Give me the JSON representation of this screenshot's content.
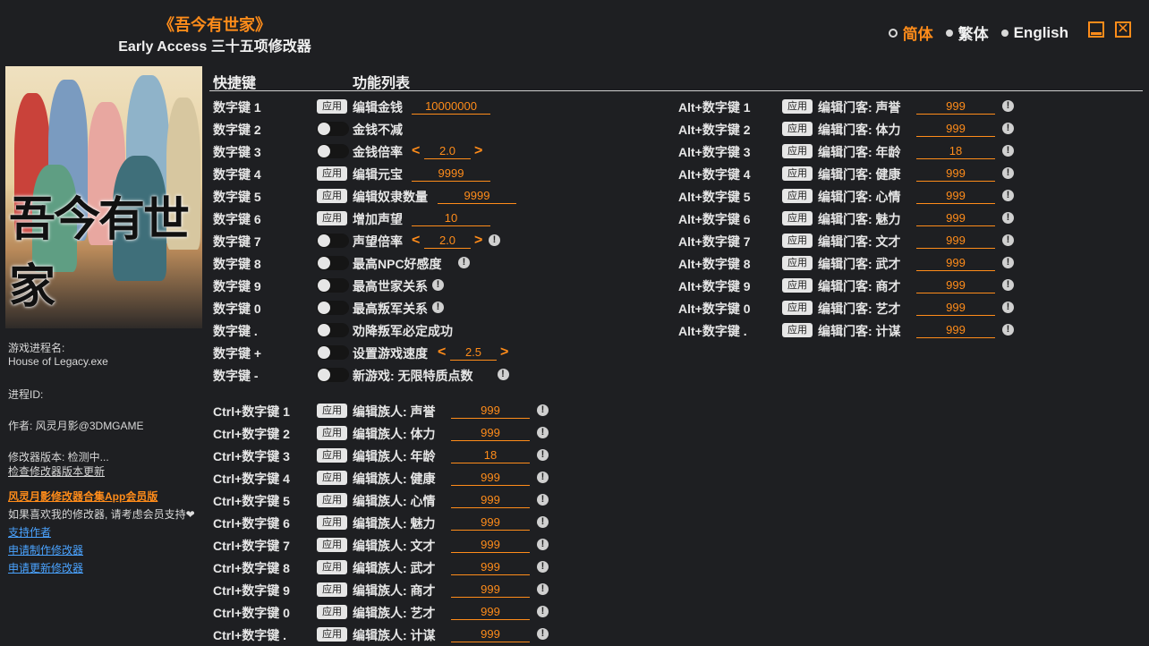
{
  "title": {
    "main": "《吾今有世家》",
    "sub": "Early Access 三十五项修改器"
  },
  "languages": [
    {
      "label": "简体",
      "selected": true
    },
    {
      "label": "繁体",
      "selected": false
    },
    {
      "label": "English",
      "selected": false
    }
  ],
  "window_controls": {
    "minimize_icon": "minimize-icon",
    "close_icon": "close-icon",
    "close_glyph": "✕"
  },
  "cover": {
    "logo_text": "吾今有世家"
  },
  "sidebar": {
    "process_name_label": "游戏进程名:",
    "process_name": "House of Legacy.exe",
    "process_id_label": "进程ID:",
    "author": "作者: 风灵月影@3DMGAME",
    "version": "修改器版本: 检测中...",
    "check_update": "检查修改器版本更新",
    "app_link": "风灵月影修改器合集App会员版",
    "support_text": "如果喜欢我的修改器, 请考虑会员支持",
    "heart": "❤",
    "links": [
      "支持作者",
      "申请制作修改器",
      "申请更新修改器"
    ]
  },
  "headers": {
    "hotkey": "快捷键",
    "function_list": "功能列表"
  },
  "controls": {
    "apply_label": "应用",
    "info_glyph": "!",
    "left_arrow": "<",
    "right_arrow": ">"
  },
  "left_rows": [
    {
      "key": "数字键 1",
      "type": "apply",
      "label": "编辑金钱",
      "value": "10000000",
      "info": false
    },
    {
      "key": "数字键 2",
      "type": "toggle",
      "label": "金钱不减",
      "info": false
    },
    {
      "key": "数字键 3",
      "type": "slider",
      "label": "金钱倍率",
      "value": "2.0",
      "info": false
    },
    {
      "key": "数字键 4",
      "type": "apply",
      "label": "编辑元宝",
      "value": "9999",
      "info": false
    },
    {
      "key": "数字键 5",
      "type": "apply",
      "label": "编辑奴隶数量",
      "value": "9999",
      "info": false
    },
    {
      "key": "数字键 6",
      "type": "apply",
      "label": "增加声望",
      "value": "10",
      "info": false
    },
    {
      "key": "数字键 7",
      "type": "slider",
      "label": "声望倍率",
      "value": "2.0",
      "info": true
    },
    {
      "key": "数字键 8",
      "type": "toggle",
      "label": "最高NPC好感度",
      "info": true
    },
    {
      "key": "数字键 9",
      "type": "toggle",
      "label": "最高世家关系",
      "info": true
    },
    {
      "key": "数字键 0",
      "type": "toggle",
      "label": "最高叛军关系",
      "info": true
    },
    {
      "key": "数字键 .",
      "type": "toggle",
      "label": "劝降叛军必定成功",
      "info": false
    },
    {
      "key": "数字键 +",
      "type": "slider",
      "label": "设置游戏速度",
      "value": "2.5",
      "info": false
    },
    {
      "key": "数字键 -",
      "type": "toggle",
      "label": "新游戏: 无限特质点数",
      "info": true
    }
  ],
  "ctrl_rows": [
    {
      "key": "Ctrl+数字键 1",
      "label": "编辑族人: 声誉",
      "value": "999"
    },
    {
      "key": "Ctrl+数字键 2",
      "label": "编辑族人: 体力",
      "value": "999"
    },
    {
      "key": "Ctrl+数字键 3",
      "label": "编辑族人: 年龄",
      "value": "18"
    },
    {
      "key": "Ctrl+数字键 4",
      "label": "编辑族人: 健康",
      "value": "999"
    },
    {
      "key": "Ctrl+数字键 5",
      "label": "编辑族人: 心情",
      "value": "999"
    },
    {
      "key": "Ctrl+数字键 6",
      "label": "编辑族人: 魅力",
      "value": "999"
    },
    {
      "key": "Ctrl+数字键 7",
      "label": "编辑族人: 文才",
      "value": "999"
    },
    {
      "key": "Ctrl+数字键 8",
      "label": "编辑族人: 武才",
      "value": "999"
    },
    {
      "key": "Ctrl+数字键 9",
      "label": "编辑族人: 商才",
      "value": "999"
    },
    {
      "key": "Ctrl+数字键 0",
      "label": "编辑族人: 艺才",
      "value": "999"
    },
    {
      "key": "Ctrl+数字键 .",
      "label": "编辑族人: 计谋",
      "value": "999"
    }
  ],
  "alt_rows": [
    {
      "key": "Alt+数字键 1",
      "label": "编辑门客: 声誉",
      "value": "999"
    },
    {
      "key": "Alt+数字键 2",
      "label": "编辑门客: 体力",
      "value": "999"
    },
    {
      "key": "Alt+数字键 3",
      "label": "编辑门客: 年龄",
      "value": "18"
    },
    {
      "key": "Alt+数字键 4",
      "label": "编辑门客: 健康",
      "value": "999"
    },
    {
      "key": "Alt+数字键 5",
      "label": "编辑门客: 心情",
      "value": "999"
    },
    {
      "key": "Alt+数字键 6",
      "label": "编辑门客: 魅力",
      "value": "999"
    },
    {
      "key": "Alt+数字键 7",
      "label": "编辑门客: 文才",
      "value": "999"
    },
    {
      "key": "Alt+数字键 8",
      "label": "编辑门客: 武才",
      "value": "999"
    },
    {
      "key": "Alt+数字键 9",
      "label": "编辑门客: 商才",
      "value": "999"
    },
    {
      "key": "Alt+数字键 0",
      "label": "编辑门客: 艺才",
      "value": "999"
    },
    {
      "key": "Alt+数字键 .",
      "label": "编辑门客: 计谋",
      "value": "999"
    }
  ],
  "colors": {
    "accent": "#ff8c1a",
    "background": "#1e1f22",
    "link": "#4aa3ff"
  }
}
